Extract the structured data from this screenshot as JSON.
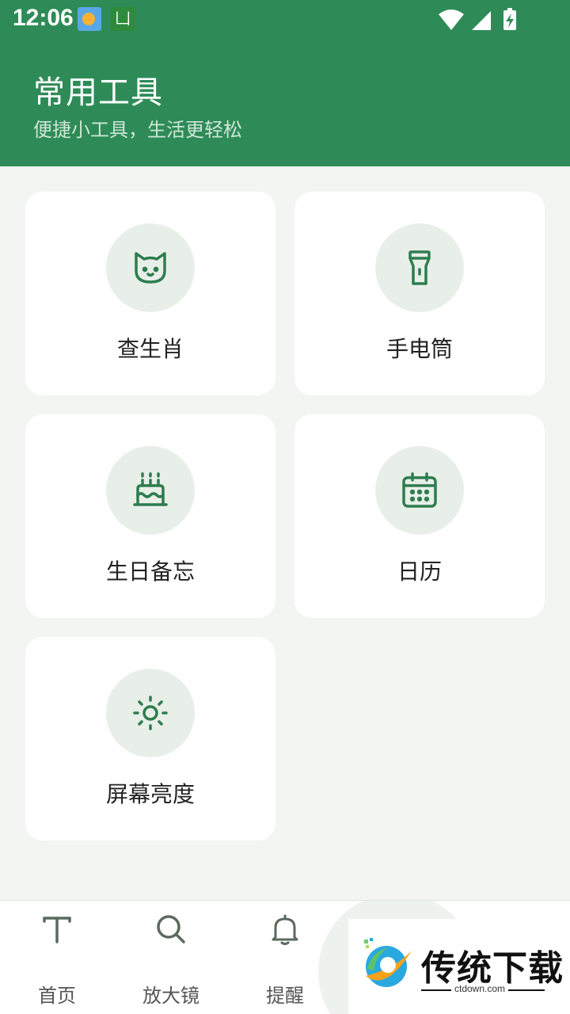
{
  "status_bar": {
    "time": "12:06",
    "app_icon_letter": "凵",
    "icons": [
      "weather-icon",
      "app-icon",
      "wifi-icon",
      "signal-icon",
      "battery-charging-icon"
    ]
  },
  "header": {
    "title": "常用工具",
    "subtitle": "便捷小工具，生活更轻松"
  },
  "tools": [
    {
      "label": "查生肖",
      "icon": "cat-icon"
    },
    {
      "label": "手电筒",
      "icon": "flashlight-icon"
    },
    {
      "label": "生日备忘",
      "icon": "birthday-cake-icon"
    },
    {
      "label": "日历",
      "icon": "calendar-icon"
    },
    {
      "label": "屏幕亮度",
      "icon": "sun-icon"
    }
  ],
  "bottom_nav": [
    {
      "label": "首页",
      "icon": "text-icon"
    },
    {
      "label": "放大镜",
      "icon": "search-icon"
    },
    {
      "label": "提醒",
      "icon": "bell-icon"
    }
  ],
  "watermark": {
    "text": "传统下载",
    "domain": "ctdown.com"
  },
  "colors": {
    "primary": "#2e8b57",
    "icon_green": "#2e7d4f",
    "circle_bg": "#e8efe8",
    "page_bg": "#f2f5f2"
  }
}
